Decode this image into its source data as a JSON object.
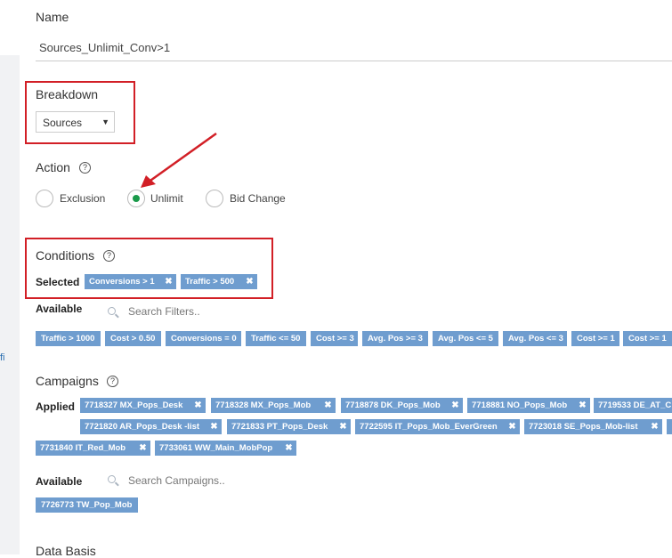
{
  "sidebar": {
    "fragment": "fi"
  },
  "name": {
    "label": "Name",
    "value": "Sources_Unlimit_Conv>1"
  },
  "breakdown": {
    "label": "Breakdown",
    "selected": "Sources"
  },
  "action": {
    "label": "Action",
    "options": [
      "Exclusion",
      "Unlimit",
      "Bid Change"
    ],
    "selected": "Unlimit"
  },
  "conditions": {
    "label": "Conditions",
    "selected_label": "Selected",
    "selected": [
      "Conversions > 1",
      "Traffic > 500"
    ],
    "available_label": "Available",
    "search_placeholder": "Search Filters..",
    "available": [
      "Traffic > 1000",
      "Cost > 0.50",
      "Conversions = 0",
      "Traffic <= 50",
      "Cost >= 3",
      "Avg. Pos >= 3",
      "Avg. Pos <= 5",
      "Avg. Pos <= 3",
      "Cost >= 1",
      "Cost >= 1"
    ]
  },
  "campaigns": {
    "label": "Campaigns",
    "applied_label": "Applied",
    "applied": [
      "7718327 MX_Pops_Desk",
      "7718328 MX_Pops_Mob",
      "7718878 DK_Pops_Mob",
      "7718881 NO_Pops_Mob",
      "7719533 DE_AT_C",
      "7721820 AR_Pops_Desk -list",
      "7721833 PT_Pops_Desk",
      "7722595 IT_Pops_Mob_EverGreen",
      "7723018 SE_Pops_Mob-list",
      "7731840 IT_Red_Mob",
      "7733061 WW_Main_MobPop"
    ],
    "available_label": "Available",
    "search_placeholder": "Search Campaigns..",
    "available": [
      "7726773 TW_Pop_Mob"
    ]
  },
  "data_basis": {
    "label": "Data Basis"
  },
  "colors": {
    "chip": "#6f9dcf",
    "highlight": "#d21f26",
    "radio_selected": "#1a9a4a"
  }
}
